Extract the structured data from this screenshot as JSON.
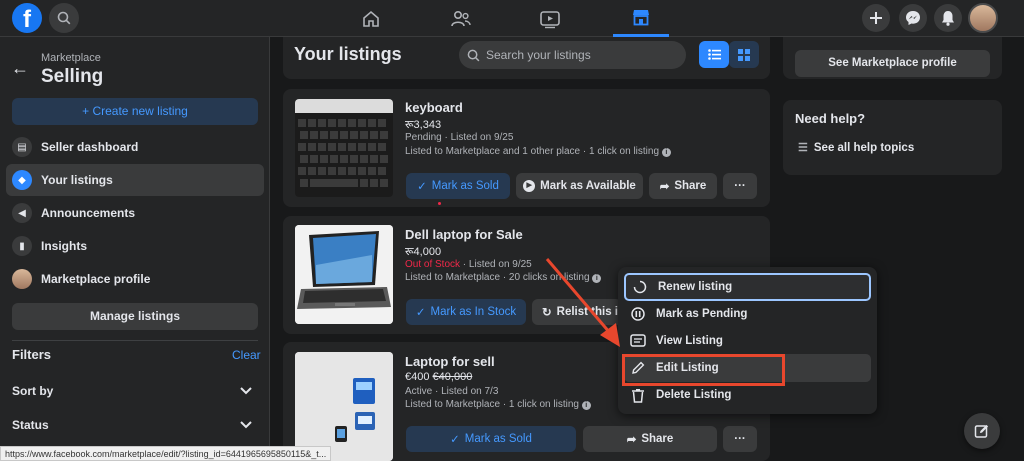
{
  "topbar": {
    "logo_letter": "f",
    "nav": [
      "home-icon",
      "friends-icon",
      "watch-icon",
      "marketplace-icon"
    ],
    "right": [
      "plus-icon",
      "messenger-icon",
      "notifications-icon",
      "profile-avatar"
    ]
  },
  "sidebar": {
    "breadcrumb": "Marketplace",
    "title": "Selling",
    "create_label": "+ Create new listing",
    "items": [
      {
        "label": "Seller dashboard",
        "icon": "dashboard-icon"
      },
      {
        "label": "Your listings",
        "icon": "tag-icon"
      },
      {
        "label": "Announcements",
        "icon": "megaphone-icon"
      },
      {
        "label": "Insights",
        "icon": "bar-chart-icon"
      },
      {
        "label": "Marketplace profile",
        "icon": "avatar"
      }
    ],
    "manage_label": "Manage listings",
    "filters_label": "Filters",
    "clear_label": "Clear",
    "filter_rows": [
      "Sort by",
      "Status"
    ]
  },
  "main": {
    "title": "Your listings",
    "search_placeholder": "Search your listings",
    "listings": [
      {
        "title": "keyboard",
        "price": "रू3,343",
        "status": "Pending",
        "listed": " · Listed on 9/25",
        "detail": "Listed to Marketplace and 1 other place · 1 click on listing",
        "buttons": [
          "Mark as Sold",
          "Mark as Available",
          "Share"
        ]
      },
      {
        "title": "Dell laptop for Sale",
        "price": "रू4,000",
        "status": "Out of Stock",
        "listed": " · Listed on 9/25",
        "detail": "Listed to Marketplace · 20 clicks on listing",
        "buttons": [
          "Mark as In Stock",
          "Relist this it"
        ]
      },
      {
        "title": "Laptop for sell",
        "price": "€400",
        "old_price": "€40,000",
        "status": "Active",
        "listed": " · Listed on 7/3",
        "detail": "Listed to Marketplace · 1 click on listing",
        "buttons": [
          "Mark as Sold",
          "Share"
        ]
      }
    ]
  },
  "right": {
    "profile_label": "See Marketplace profile",
    "help_title": "Need help?",
    "help_link": "See all help topics"
  },
  "menu": {
    "items": [
      "Renew listing",
      "Mark as Pending",
      "View Listing",
      "Edit Listing",
      "Delete Listing"
    ]
  },
  "status_url": "https://www.facebook.com/marketplace/edit/?listing_id=6441965695850115&_t..."
}
